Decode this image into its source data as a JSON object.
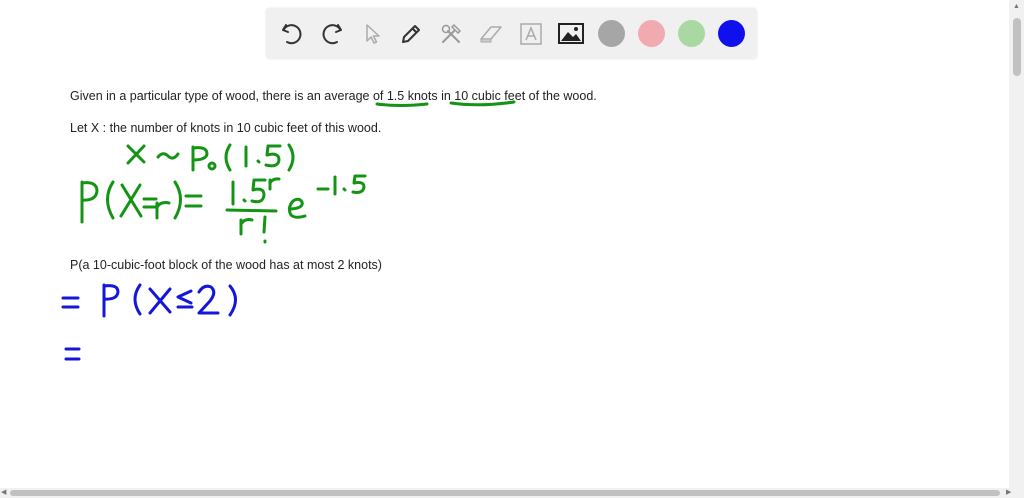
{
  "toolbar": {
    "tools": [
      {
        "name": "undo-icon",
        "enabled": true
      },
      {
        "name": "redo-icon",
        "enabled": true
      },
      {
        "name": "select-pointer-icon",
        "enabled": false
      },
      {
        "name": "pen-icon",
        "enabled": true
      },
      {
        "name": "tools-icon",
        "enabled": false
      },
      {
        "name": "eraser-icon",
        "enabled": false
      },
      {
        "name": "text-tool-icon",
        "enabled": false
      },
      {
        "name": "image-insert-icon",
        "enabled": true
      }
    ],
    "colors": [
      {
        "name": "gray",
        "hex": "#a6a6a6"
      },
      {
        "name": "pink",
        "hex": "#f0aab0"
      },
      {
        "name": "light-green",
        "hex": "#a9d8a2"
      },
      {
        "name": "blue",
        "hex": "#1010ee",
        "selected": true
      }
    ]
  },
  "content": {
    "line1_pre": "Given in a particular type of wood, there is an average of ",
    "line1_knots": "1.5 knots",
    "line1_mid": " in ",
    "line1_feet": "10 cubic feet",
    "line1_post": " of the wood.",
    "line2": "Let X : the number of knots in 10 cubic feet of this wood.",
    "line3": "P(a 10-cubic-foot block of the wood has at most 2 knots)"
  },
  "handwriting": {
    "green_color": "#149414",
    "blue_color": "#1515dd",
    "distribution": "X ~ P₀(1.5)",
    "pmf": "P(X=r) = 1.5^r / r! e^-1.5",
    "step1": "= P(X ≤ 2)",
    "step2": "="
  }
}
